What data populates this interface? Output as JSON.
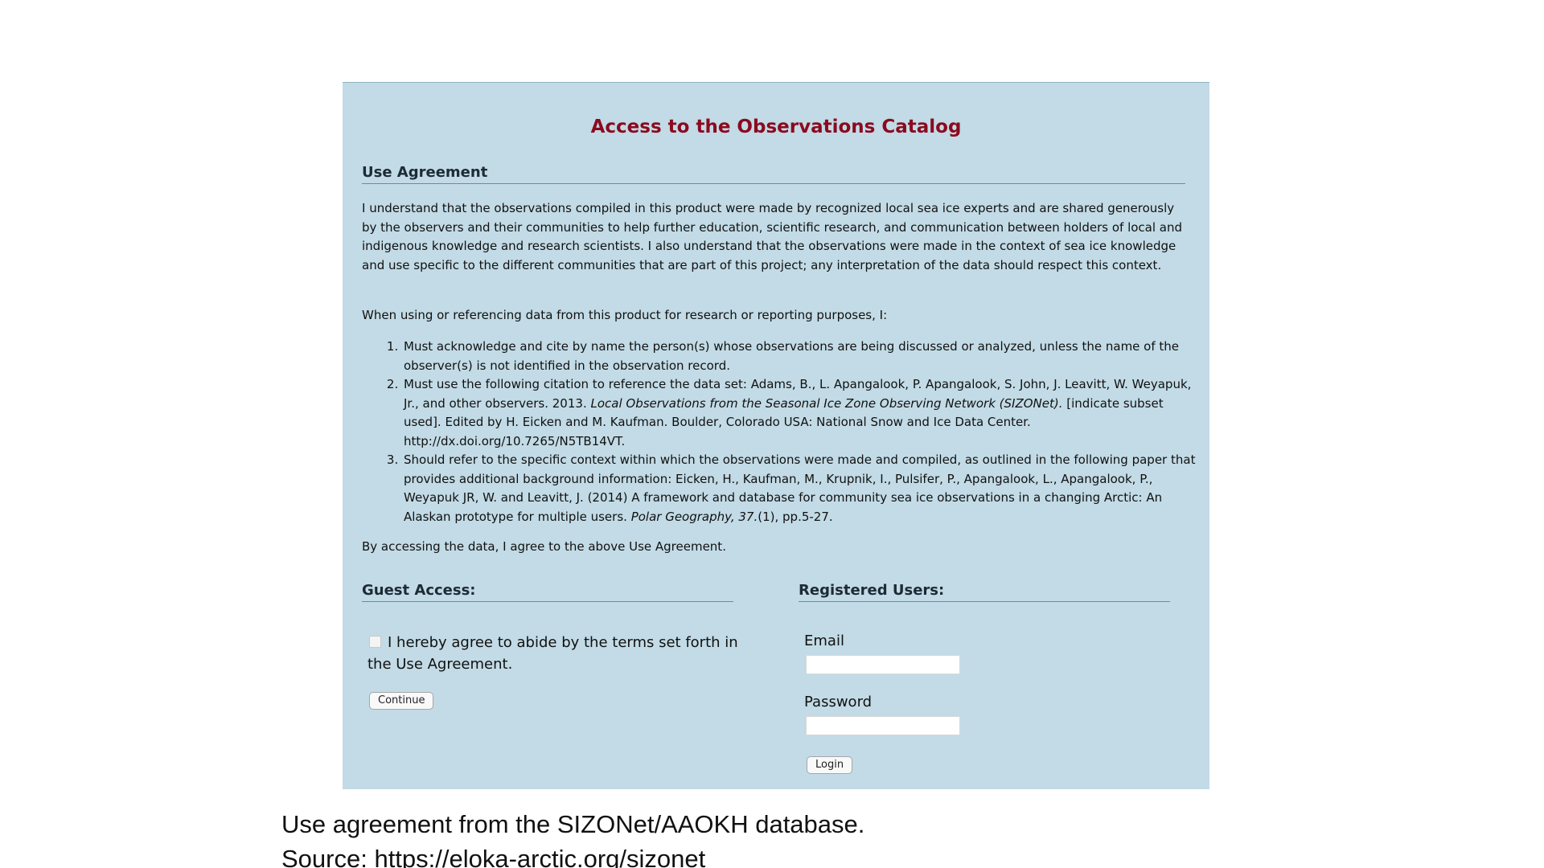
{
  "panel": {
    "title": "Access to the Observations Catalog",
    "use_agreement": {
      "heading": "Use Agreement",
      "intro": "I understand that the observations compiled in this product were made by recognized local sea ice experts and are shared generously by the observers and their communities to help further education, scientific research, and communication between holders of local and indigenous knowledge and research scientists. I also understand that the observations were made in the context of sea ice knowledge and use specific to the different communities that are part of this project; any interpretation of the data should respect this context.",
      "when_using": "When using or referencing data from this product for research or reporting purposes, I:",
      "items": [
        {
          "text": "Must acknowledge and cite by name the person(s) whose observations are being discussed or analyzed, unless the name of the observer(s) is not identified in the observation record."
        },
        {
          "text_before": "Must use the following citation to reference the data set: Adams, B., L. Apangalook, P. Apangalook, S. John, J. Leavitt, W. Weyapuk, Jr., and other observers. 2013. ",
          "italic": "Local Observations from the Seasonal Ice Zone Observing Network (SIZONet).",
          "text_after": " [indicate subset used]. Edited by H. Eicken and M. Kaufman. Boulder, Colorado USA: National Snow and Ice Data Center. http://dx.doi.org/10.7265/N5TB14VT."
        },
        {
          "text_before": "Should refer to the specific context within which the observations were made and compiled, as outlined in the following paper that provides additional background information: Eicken, H., Kaufman, M., Krupnik, I., Pulsifer, P., Apangalook, L., Apangalook, P., Weyapuk JR, W. and Leavitt, J. (2014) A framework and database for community sea ice observations in a changing Arctic: An Alaskan prototype for multiple users. ",
          "italic": "Polar Geography, 37.",
          "text_after": "(1), pp.5-27."
        }
      ],
      "closing": "By accessing the data, I agree to the above Use Agreement."
    },
    "guest": {
      "heading": "Guest Access:",
      "agree_text": "I hereby agree to abide by the terms set forth in the Use Agreement.",
      "checked": false,
      "continue_label": "Continue"
    },
    "registered": {
      "heading": "Registered Users:",
      "email_label": "Email",
      "email_value": "",
      "password_label": "Password",
      "password_value": "",
      "login_label": "Login"
    }
  },
  "caption": {
    "line1": "Use agreement from the SIZONet/AAOKH database.",
    "line2": "Source: https://eloka-arctic.org/sizonet"
  },
  "colors": {
    "panel_background": "#c2dbe6",
    "title": "#8b0a1f"
  }
}
